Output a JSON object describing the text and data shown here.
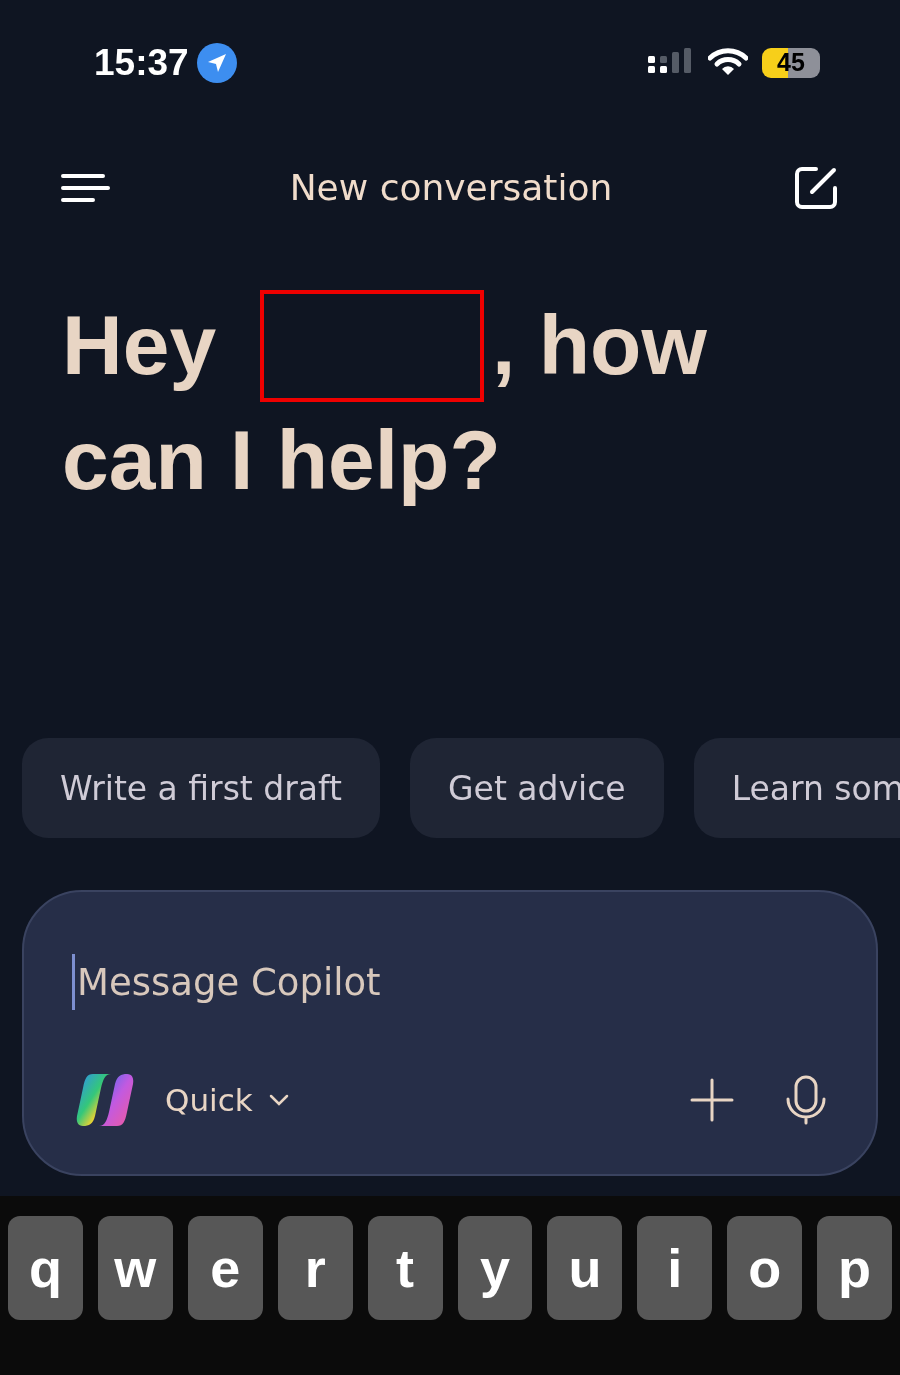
{
  "status_bar": {
    "time": "15:37",
    "battery": "45"
  },
  "header": {
    "title": "New conversation"
  },
  "greeting": {
    "before": "Hey",
    "after": ", how",
    "second_line": "can I help?",
    "redacted": true
  },
  "suggestions": [
    {
      "label": "Write a first draft"
    },
    {
      "label": "Get advice"
    },
    {
      "label": "Learn som"
    }
  ],
  "composer": {
    "placeholder": "Message Copilot",
    "mode": "Quick"
  },
  "keyboard": {
    "keys": [
      "q",
      "w",
      "e",
      "r",
      "t",
      "y",
      "u",
      "i",
      "o",
      "p"
    ]
  }
}
